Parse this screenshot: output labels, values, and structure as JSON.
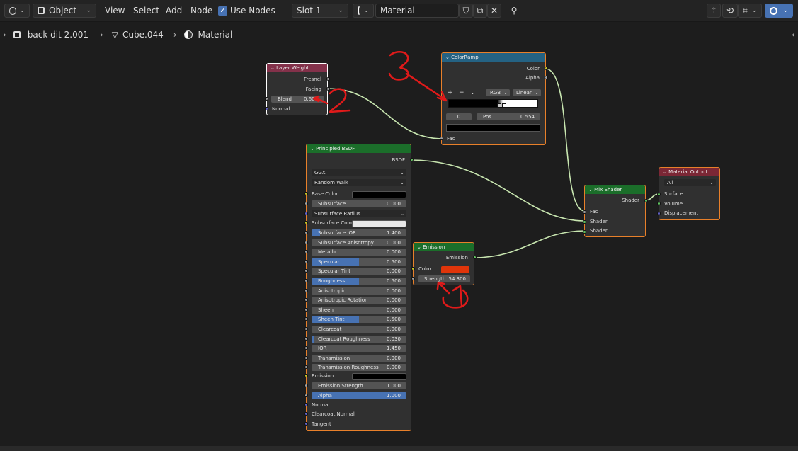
{
  "header": {
    "mode": "Object",
    "menus": [
      "View",
      "Select",
      "Add",
      "Node"
    ],
    "use_nodes_label": "Use Nodes",
    "slot": "Slot 1",
    "material": "Material"
  },
  "breadcrumb": {
    "object": "back dit 2.001",
    "mesh": "Cube.044",
    "material": "Material"
  },
  "layer_weight": {
    "title": "Layer Weight",
    "outputs": [
      "Fresnel",
      "Facing"
    ],
    "blend_label": "Blend",
    "blend_value": "0.600",
    "normal_label": "Normal"
  },
  "colorramp": {
    "title": "ColorRamp",
    "outputs": [
      "Color",
      "Alpha"
    ],
    "color_mode": "RGB",
    "interpolation": "Linear",
    "plus": "+",
    "minus": "−",
    "index": "0",
    "pos_label": "Pos",
    "pos_value": "0.554",
    "fac_label": "Fac"
  },
  "principled": {
    "title": "Principled BSDF",
    "output": "BSDF",
    "distribution": "GGX",
    "subsurface_method": "Random Walk",
    "base_color_label": "Base Color",
    "subsurface_radius": "Subsurface Radius",
    "subsurface_color_label": "Subsurface Color",
    "emission_label": "Emission",
    "normal": "Normal",
    "clearcoat_normal": "Clearcoat Normal",
    "tangent": "Tangent",
    "sliders_a": [
      {
        "label": "Subsurface",
        "value": "0.000",
        "fill": 0
      }
    ],
    "sliders_b": [
      {
        "label": "Subsurface IOR",
        "value": "1.400",
        "fill": 0.09
      },
      {
        "label": "Subsurface Anisotropy",
        "value": "0.000",
        "fill": 0
      },
      {
        "label": "Metallic",
        "value": "0.000",
        "fill": 0
      },
      {
        "label": "Specular",
        "value": "0.500",
        "fill": 0.5
      },
      {
        "label": "Specular Tint",
        "value": "0.000",
        "fill": 0
      },
      {
        "label": "Roughness",
        "value": "0.500",
        "fill": 0.5
      },
      {
        "label": "Anisotropic",
        "value": "0.000",
        "fill": 0
      },
      {
        "label": "Anisotropic Rotation",
        "value": "0.000",
        "fill": 0
      },
      {
        "label": "Sheen",
        "value": "0.000",
        "fill": 0
      },
      {
        "label": "Sheen Tint",
        "value": "0.500",
        "fill": 0.5
      },
      {
        "label": "Clearcoat",
        "value": "0.000",
        "fill": 0
      },
      {
        "label": "Clearcoat Roughness",
        "value": "0.030",
        "fill": 0.03
      },
      {
        "label": "IOR",
        "value": "1.450",
        "fill": 0
      },
      {
        "label": "Transmission",
        "value": "0.000",
        "fill": 0
      },
      {
        "label": "Transmission Roughness",
        "value": "0.000",
        "fill": 0
      }
    ],
    "sliders_c": [
      {
        "label": "Emission Strength",
        "value": "1.000",
        "fill": 0
      },
      {
        "label": "Alpha",
        "value": "1.000",
        "fill": 1
      }
    ]
  },
  "emission": {
    "title": "Emission",
    "output": "Emission",
    "color_label": "Color",
    "strength_label": "Strength",
    "strength_value": "54.300"
  },
  "mix_shader": {
    "title": "Mix Shader",
    "output": "Shader",
    "inputs": [
      "Fac",
      "Shader",
      "Shader"
    ]
  },
  "material_output": {
    "title": "Material Output",
    "target": "All",
    "inputs": [
      "Surface",
      "Volume",
      "Displacement"
    ]
  },
  "colors": {
    "header_input": "#83314a",
    "header_converter": "#246283",
    "header_shader": "#1b6e2a",
    "header_output": "#7b2735",
    "emission_color": "#e0350a",
    "annotation": "#e01a1a",
    "wire": "#c8e6b0"
  }
}
